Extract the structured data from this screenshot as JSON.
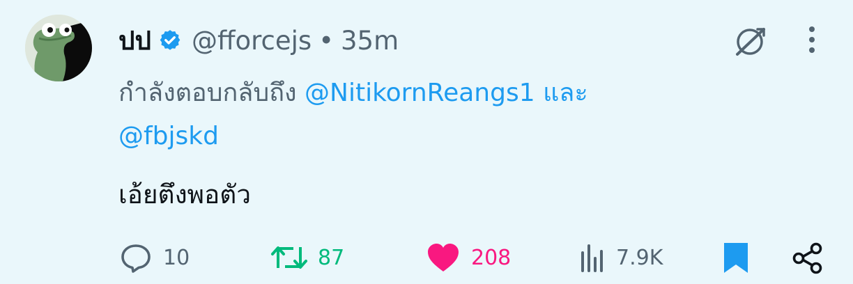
{
  "tweet": {
    "display_name": "ปป",
    "handle": "@fforcejs",
    "separator": "•",
    "time": "35m",
    "reply_prefix": "กำลังตอบกลับถึง",
    "mention_1": "@NitikornReangs1",
    "and_word": "และ",
    "mention_2": "@fbjskd",
    "text": "เอ้ยตึงพอตัว"
  },
  "actions": {
    "replies": "10",
    "retweets": "87",
    "likes": "208",
    "views": "7.9K"
  },
  "colors": {
    "background": "#eaf7fb",
    "mention": "#1d9bf0",
    "verified": "#1d9bf0",
    "retweet": "#00ba7c",
    "like": "#f91880",
    "bookmark": "#1d9bf0",
    "muted": "#536471"
  },
  "icons": {
    "verified": "verified-badge-icon",
    "grok": "grok-icon",
    "more": "more-vertical-icon",
    "reply": "reply-icon",
    "retweet": "retweet-icon",
    "like": "heart-icon",
    "views": "views-icon",
    "bookmark": "bookmark-icon",
    "share": "share-icon"
  }
}
